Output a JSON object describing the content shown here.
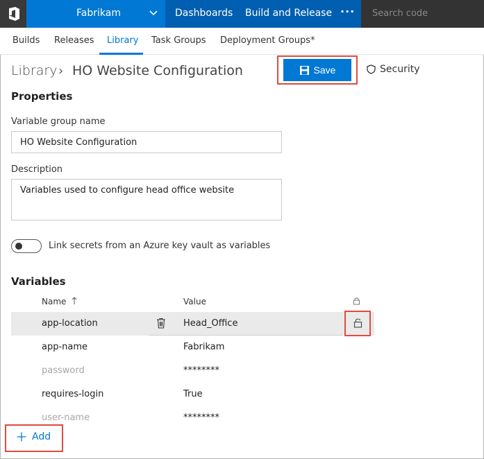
{
  "topbar": {
    "project": "Fabrikam",
    "hubs": [
      "Dashboards",
      "Build and Release"
    ],
    "more": "···",
    "search_placeholder": "Search code"
  },
  "tabs": [
    {
      "label": "Builds"
    },
    {
      "label": "Releases"
    },
    {
      "label": "Library",
      "active": true
    },
    {
      "label": "Task Groups"
    },
    {
      "label": "Deployment Groups*"
    }
  ],
  "header": {
    "breadcrumb_root": "Library",
    "separator": "›",
    "title": "HO Website Configuration",
    "save_label": "Save",
    "security_label": "Security"
  },
  "properties": {
    "heading": "Properties",
    "name_label": "Variable group name",
    "name_value": "HO Website Configuration",
    "description_label": "Description",
    "description_value": "Variables used to configure head office website",
    "keyvault_label": "Link secrets from an Azure key vault as variables"
  },
  "variables": {
    "heading": "Variables",
    "col_name": "Name",
    "col_value": "Value",
    "rows": [
      {
        "name": "app-location",
        "value": "Head_Office",
        "secret": false
      },
      {
        "name": "app-name",
        "value": "Fabrikam",
        "secret": false
      },
      {
        "name": "password",
        "value": "********",
        "secret": true
      },
      {
        "name": "requires-login",
        "value": "True",
        "secret": false
      },
      {
        "name": "user-name",
        "value": "********",
        "secret": true
      }
    ],
    "add_label": "Add"
  },
  "colors": {
    "accent": "#0078d4",
    "highlight": "#e04a3f"
  }
}
